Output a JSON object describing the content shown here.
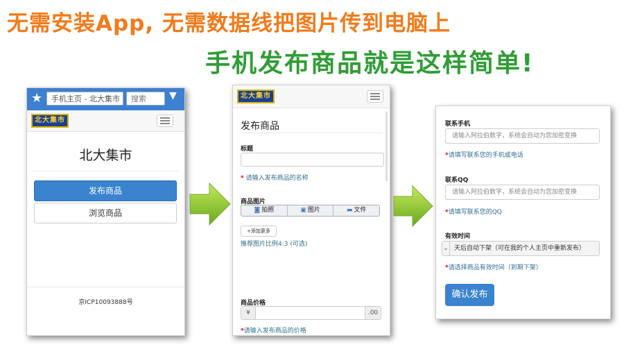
{
  "headline": {
    "line1": "无需安装App, 无需数据线把图片传到电脑上",
    "line2": "手机发布商品就是这样简单!"
  },
  "colors": {
    "line1": "#f27a1a",
    "line2": "#2f9d35",
    "primary": "#3a83cf",
    "hint": "#31708f",
    "required": "#d9001b"
  },
  "phone1": {
    "url": "手机主页 - 北大集市",
    "search_placeholder": "搜索",
    "star_icon": "star-icon",
    "logo": "北大集市",
    "title": "北大集市",
    "publish_button": "发布商品",
    "browse_button": "浏览商品",
    "icp": "京ICP10093888号"
  },
  "phone2": {
    "logo": "北大集市",
    "section_title": "发布商品",
    "title_label": "标题",
    "title_hint": "请输入发布商品的名称",
    "image_label": "商品图片",
    "photo_button": "拍照",
    "picture_button": "图片",
    "file_button": "文件",
    "add_more": "+添加更多",
    "ratio_hint": "推荐图片比例4:3 (可选)",
    "price_label": "商品价格",
    "currency": "¥",
    "cents": ".00",
    "price_hint": "请输入发布商品的价格"
  },
  "phone3": {
    "phone_label": "联系手机",
    "phone_placeholder": "请输入阿拉伯数字，系统会自动为您加密变换",
    "phone_hint": "请填写联系您的手机或电话",
    "qq_label": "联系QQ",
    "qq_placeholder": "请输入阿拉伯数字，系统会自动为您加密变换",
    "qq_hint": "请填写联系您的QQ",
    "valid_label": "有效时间",
    "valid_value": "天后自动下架（可在我的个人主页中重新发布）",
    "valid_hint": "请选择商品有效时间（到期下架）",
    "confirm_button": "确认发布"
  },
  "required_mark": "*"
}
